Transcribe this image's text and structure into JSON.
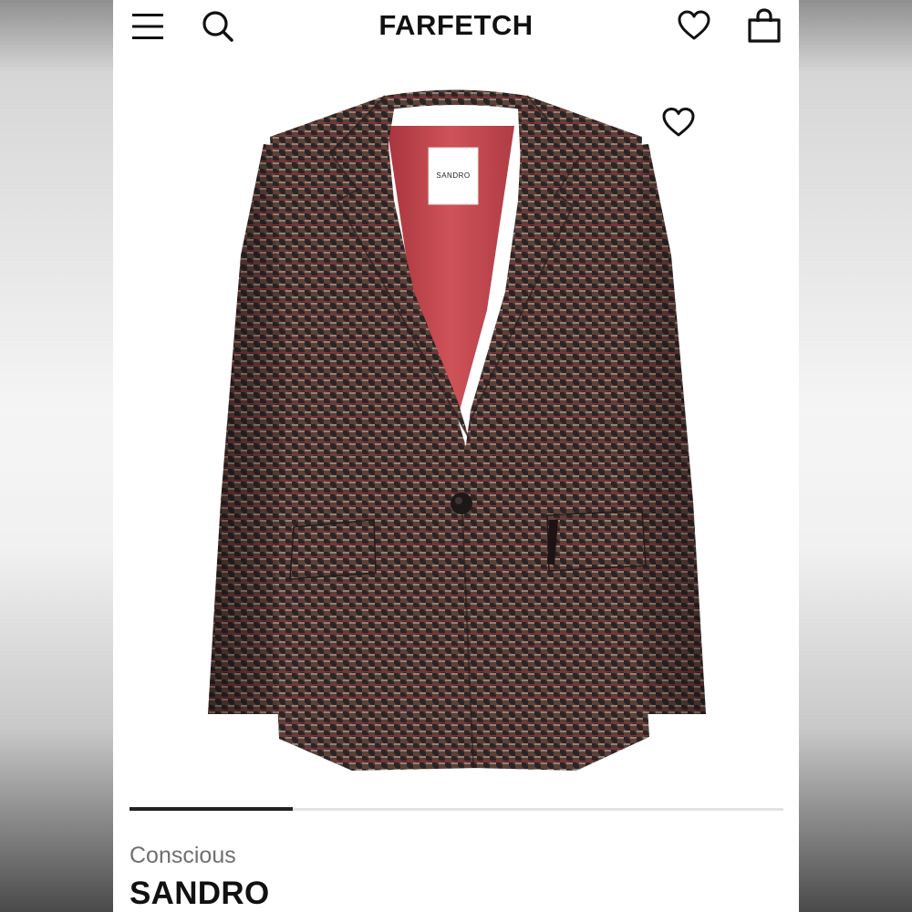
{
  "app": {
    "logo": "FARFETCH"
  },
  "header": {
    "menu_icon": "hamburger-menu-icon",
    "search_icon": "search-icon",
    "wishlist_icon": "heart-icon",
    "bag_icon": "shopping-bag-icon"
  },
  "product": {
    "image_label": "SANDRO",
    "badge": "Conscious",
    "brand": "SANDRO",
    "wishlist_icon": "heart-outline-icon",
    "carousel_progress": 0.25
  },
  "colors": {
    "fabric_base": "#5b4138",
    "fabric_dark": "#2b2426",
    "fabric_red": "#8a2f3a",
    "fabric_light": "#a8968a",
    "lining": "#c8474f",
    "accent": "#111111"
  }
}
